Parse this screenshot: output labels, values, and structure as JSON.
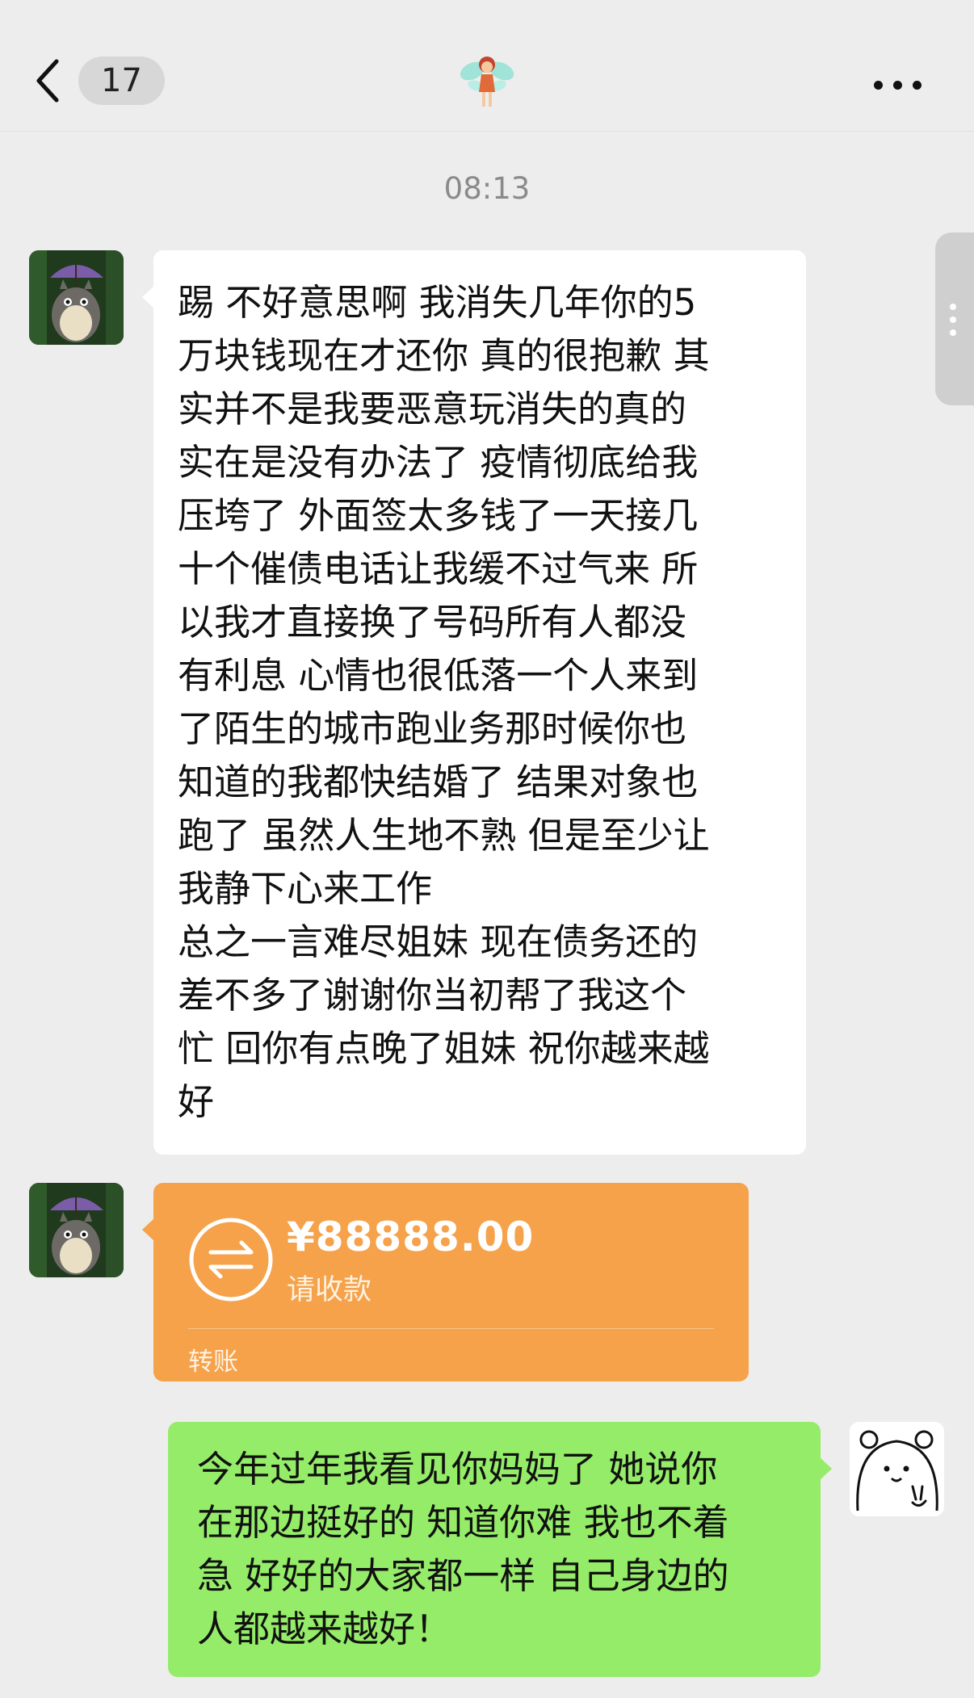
{
  "header": {
    "unread_count": "17",
    "chat_icon": "fairy-emoji-icon",
    "back_icon": "chevron-left-icon",
    "more_icon": "more-dots-icon"
  },
  "timestamp": "08:13",
  "messages": [
    {
      "side": "in",
      "type": "text",
      "text": "踢 不好意思啊 我消失几年你的5\n万块钱现在才还你 真的很抱歉 其\n实并不是我要恶意玩消失的真的\n实在是没有办法了 疫情彻底给我\n压垮了 外面签太多钱了一天接几\n十个催债电话让我缓不过气来 所\n以我才直接换了号码所有人都没\n有利息 心情也很低落一个人来到\n了陌生的城市跑业务那时候你也\n知道的我都快结婚了 结果对象也\n跑了 虽然人生地不熟 但是至少让\n我静下心来工作\n总之一言难尽姐妹 现在债务还的\n差不多了谢谢你当初帮了我这个\n忙 回你有点晚了姐妹 祝你越来越\n好"
    },
    {
      "side": "in",
      "type": "transfer",
      "amount": "¥88888.00",
      "status": "请收款",
      "label": "转账",
      "icon": "transfer-arrows-icon"
    },
    {
      "side": "out",
      "type": "text",
      "text": "今年过年我看见你妈妈了 她说你\n在那边挺好的 知道你难 我也不着\n急 好好的大家都一样 自己身边的\n人都越来越好！"
    }
  ],
  "colors": {
    "background": "#ededed",
    "incoming_bubble": "#ffffff",
    "outgoing_bubble": "#95ec69",
    "transfer_card": "#f5a24b"
  }
}
